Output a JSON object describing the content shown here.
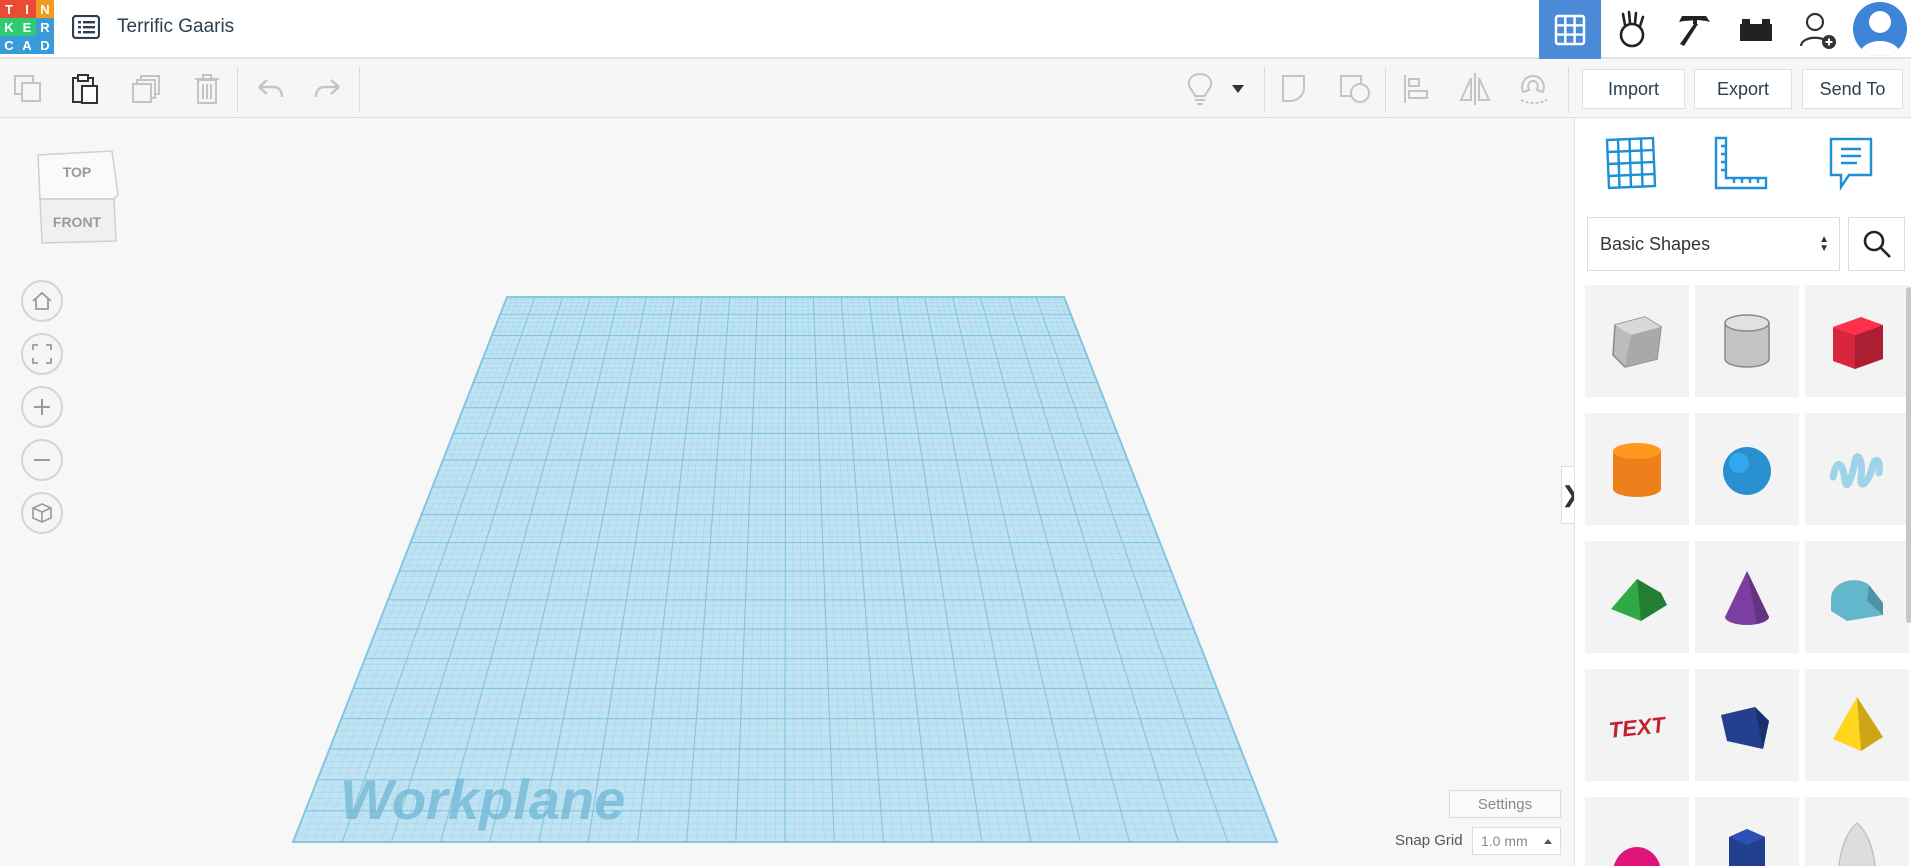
{
  "app": {
    "logo_letters": [
      "T",
      "I",
      "N",
      "K",
      "E",
      "R",
      "C",
      "A",
      "D"
    ],
    "logo_colors": [
      "#e94b35",
      "#e94b35",
      "#f29c1f",
      "#2ecc71",
      "#2ecc71",
      "#3a9bd9",
      "#3a9bd9",
      "#3a9bd9",
      "#3a9bd9"
    ],
    "design_title": "Terrific Gaaris"
  },
  "header": {
    "icons": [
      {
        "name": "3d-design-grid-icon",
        "active": true
      },
      {
        "name": "circuits-hand-icon",
        "active": false
      },
      {
        "name": "minecraft-pickaxe-icon",
        "active": false
      },
      {
        "name": "lego-brick-icon",
        "active": false
      },
      {
        "name": "add-user-icon",
        "active": false
      }
    ]
  },
  "toolbar": {
    "import_label": "Import",
    "export_label": "Export",
    "send_to_label": "Send To"
  },
  "viewport": {
    "viewcube": {
      "top_label": "TOP",
      "front_label": "FRONT"
    },
    "workplane_label": "Workplane",
    "settings_label": "Settings",
    "snap_grid_label": "Snap Grid",
    "snap_grid_value": "1.0 mm",
    "workplane_color": "#bfe3f2",
    "grid_line_color": "#7cc2e0"
  },
  "panel": {
    "shape_category": "Basic Shapes",
    "shapes": [
      {
        "name": "box-hole-shape",
        "color": "#bcbcbc"
      },
      {
        "name": "cylinder-hole-shape",
        "color": "#c4c4c4"
      },
      {
        "name": "box-shape",
        "color": "#d7263d"
      },
      {
        "name": "cylinder-shape",
        "color": "#ee7f1a"
      },
      {
        "name": "sphere-shape",
        "color": "#2a8fcf"
      },
      {
        "name": "scribble-shape",
        "color": "#9fd3e8"
      },
      {
        "name": "roof-shape",
        "color": "#2fa845"
      },
      {
        "name": "cone-shape",
        "color": "#7c3fa1"
      },
      {
        "name": "round-roof-shape",
        "color": "#62b7cd"
      },
      {
        "name": "text-shape",
        "color": "#c4202f"
      },
      {
        "name": "wedge-shape",
        "color": "#23408f"
      },
      {
        "name": "pyramid-shape",
        "color": "#f2c21b"
      },
      {
        "name": "half-sphere-shape",
        "color": "#e0157c"
      },
      {
        "name": "polygon-shape",
        "color": "#23408f"
      },
      {
        "name": "paraboloid-shape",
        "color": "#dddddd"
      }
    ]
  }
}
